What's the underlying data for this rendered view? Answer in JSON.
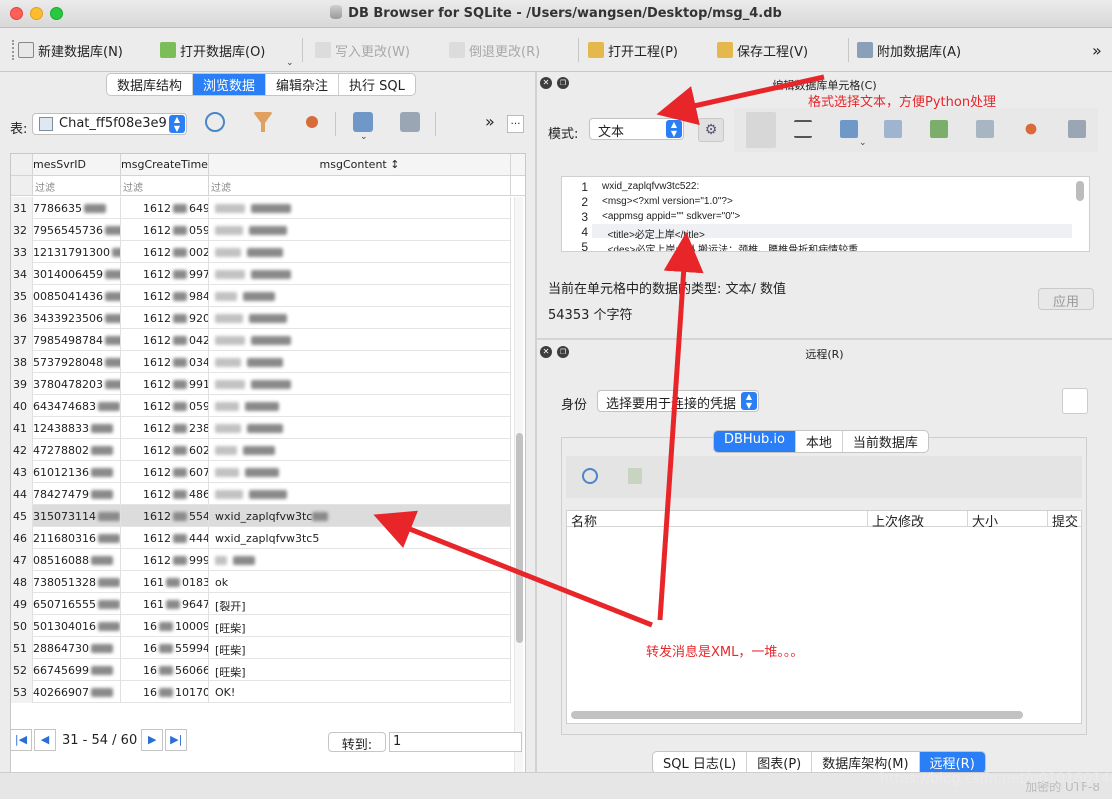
{
  "window": {
    "title": "DB Browser for SQLite - /Users/wangsen/Desktop/msg_4.db"
  },
  "toolbar": {
    "new_db": "新建数据库(N)",
    "open_db": "打开数据库(O)",
    "write_changes": "写入更改(W)",
    "revert_changes": "倒退更改(R)",
    "open_project": "打开工程(P)",
    "save_project": "保存工程(V)",
    "attach_db": "附加数据库(A)",
    "more": "»"
  },
  "left_tabs": [
    "数据库结构",
    "浏览数据",
    "编辑杂注",
    "执行 SQL"
  ],
  "browse": {
    "table_label": "表:",
    "table_value": "Chat_ff5f08e3e9",
    "more": "…",
    "columns": [
      "mesSvrID",
      "msgCreateTime",
      "msgContent ↕"
    ],
    "filter_placeholder": "过滤",
    "rows": [
      {
        "n": "31",
        "a": "7786635",
        "b": "1612",
        "b2": "649",
        "c": ""
      },
      {
        "n": "32",
        "a": "7956545736",
        "b": "1612",
        "b2": "059",
        "c": ""
      },
      {
        "n": "33",
        "a": "12131791300",
        "b": "1612",
        "b2": "002",
        "c": ""
      },
      {
        "n": "34",
        "a": "3014006459",
        "b": "1612",
        "b2": "9978",
        "c": ""
      },
      {
        "n": "35",
        "a": "0085041436",
        "b": "1612",
        "b2": "984",
        "c": ""
      },
      {
        "n": "36",
        "a": "3433923506",
        "b": "1612",
        "b2": "920",
        "c": ""
      },
      {
        "n": "37",
        "a": "7985498784",
        "b": "1612",
        "b2": "042",
        "c": ""
      },
      {
        "n": "38",
        "a": "5737928048",
        "b": "1612",
        "b2": "034",
        "c": ""
      },
      {
        "n": "39",
        "a": "3780478203",
        "b": "1612",
        "b2": "991",
        "c": ""
      },
      {
        "n": "40",
        "a": "643474683",
        "b": "1612",
        "b2": "059",
        "c": ""
      },
      {
        "n": "41",
        "a": "12438833",
        "b": "1612",
        "b2": "2388",
        "c": ""
      },
      {
        "n": "42",
        "a": "47278802",
        "b": "1612",
        "b2": "6024",
        "c": ""
      },
      {
        "n": "43",
        "a": "61012136",
        "b": "1612",
        "b2": "6072",
        "c": ""
      },
      {
        "n": "44",
        "a": "78427479",
        "b": "1612",
        "b2": "486",
        "c": ""
      },
      {
        "n": "45",
        "a": "315073114",
        "b": "1612",
        "b2": "554",
        "c": "wxid_zaplqfvw3tc"
      },
      {
        "n": "46",
        "a": "211680316",
        "b": "1612",
        "b2": "444",
        "c": "wxid_zaplqfvw3tc5"
      },
      {
        "n": "47",
        "a": "08516088",
        "b": "1612",
        "b2": "999",
        "c": ""
      },
      {
        "n": "48",
        "a": "738051328",
        "b": "161",
        "b2": "0183",
        "c": "ok"
      },
      {
        "n": "49",
        "a": "650716555",
        "b": "161",
        "b2": "9647",
        "c": "[裂开]"
      },
      {
        "n": "50",
        "a": "501304016",
        "b": "16",
        "b2": "10009",
        "c": "[旺柴]"
      },
      {
        "n": "51",
        "a": "28864730",
        "b": "16",
        "b2": "55994",
        "c": "[旺柴]"
      },
      {
        "n": "52",
        "a": "66745699",
        "b": "16",
        "b2": "56066",
        "c": "[旺柴]"
      },
      {
        "n": "53",
        "a": "40266907",
        "b": "16",
        "b2": "10170",
        "c": "OK!"
      }
    ],
    "pager": "31 - 54 / 60",
    "goto_label": "转到:",
    "goto_value": "1"
  },
  "edit_cell": {
    "title": "编辑数据库单元格(C)",
    "mode_label": "模式:",
    "mode_value": "文本",
    "lines": [
      {
        "n": "1",
        "text": "wxid_zaplqfvw3tc522:"
      },
      {
        "n": "2",
        "text": "<msg><?xml version=\"1.0\"?>"
      },
      {
        "n": "3",
        "text": "<appmsg appid=\"\" sdkver=\"0\">"
      },
      {
        "n": "4",
        "text": "  <title>必定上岸</title>"
      },
      {
        "n": "5",
        "text": "  <des>必定上岸:四人搬运法：颈椎、腰椎骨折和病情较重"
      }
    ],
    "type_text": "当前在单元格中的数据的类型: 文本/ 数值",
    "char_count": "54353 个字符",
    "apply": "应用"
  },
  "remote": {
    "title": "远程(R)",
    "identity_label": "身份",
    "identity_value": "选择要用于连接的凭据",
    "tabs": [
      "DBHub.io",
      "本地",
      "当前数据库"
    ],
    "columns": [
      "名称",
      "上次修改",
      "大小",
      "提交"
    ]
  },
  "bottom_tabs": [
    "SQL 日志(L)",
    "图表(P)",
    "数据库架构(M)",
    "远程(R)"
  ],
  "status": {
    "encoding": "加密的 UTF-8"
  },
  "annotations": {
    "top": "格式选择文本，方便Python处理",
    "bottom": "转发消息是XML，一堆。。。",
    "color": "#e8262a"
  },
  "watermark": "https://blog.csdn.net/u010160146",
  "colors": {
    "accent": "#2b7ff6",
    "annotation": "#e8262a"
  }
}
